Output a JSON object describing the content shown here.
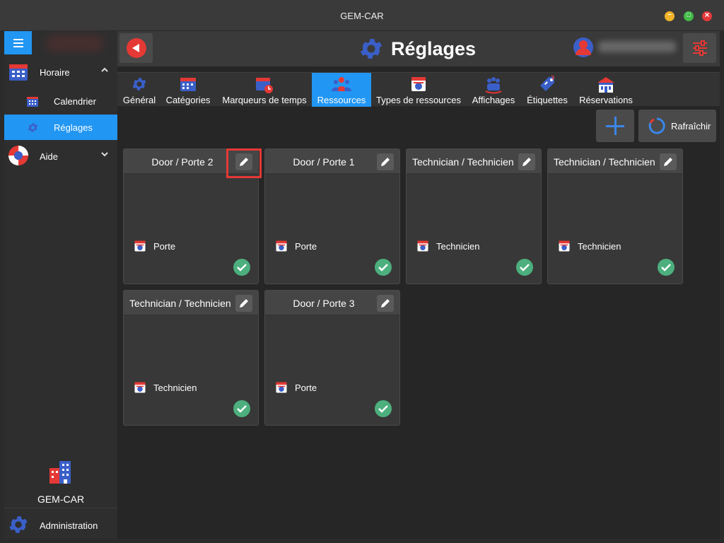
{
  "window": {
    "title": "GEM-CAR"
  },
  "sidebar": {
    "groups": [
      {
        "label": "Horaire",
        "expanded": true,
        "icon": "calendar-icon"
      },
      {
        "label": "Aide",
        "expanded": false,
        "icon": "lifebuoy-icon"
      }
    ],
    "items": [
      {
        "label": "Calendrier",
        "icon": "calendar-grid-icon",
        "active": false
      },
      {
        "label": "Réglages",
        "icon": "gear-icon",
        "active": true
      }
    ],
    "brand_label": "GEM-CAR",
    "admin_label": "Administration"
  },
  "header": {
    "title": "Réglages"
  },
  "tabs": [
    {
      "label": "Général",
      "icon": "gear-icon"
    },
    {
      "label": "Catégories",
      "icon": "calendar-icon"
    },
    {
      "label": "Marqueurs de temps",
      "icon": "calendar-clock-icon"
    },
    {
      "label": "Ressources",
      "icon": "people-icon",
      "active": true
    },
    {
      "label": "Types de ressources",
      "icon": "resource-type-icon"
    },
    {
      "label": "Affichages",
      "icon": "display-icon"
    },
    {
      "label": "Étiquettes",
      "icon": "tag-icon"
    },
    {
      "label": "Réservations",
      "icon": "building-icon"
    }
  ],
  "actions": {
    "refresh_label": "Rafraîchir"
  },
  "cards": [
    {
      "title": "Door / Porte 2",
      "type": "Porte",
      "active": true
    },
    {
      "title": "Door / Porte 1",
      "type": "Porte",
      "active": true
    },
    {
      "title": "Technician / Technicien",
      "type": "Technicien",
      "active": true
    },
    {
      "title": "Technician / Technicien",
      "type": "Technicien",
      "active": true
    },
    {
      "title": "Technician / Technicien",
      "type": "Technicien",
      "active": true
    },
    {
      "title": "Door / Porte 3",
      "type": "Porte",
      "active": true
    }
  ],
  "colors": {
    "accent": "#2196f3",
    "danger": "#e53935",
    "success": "#4caf7d"
  }
}
